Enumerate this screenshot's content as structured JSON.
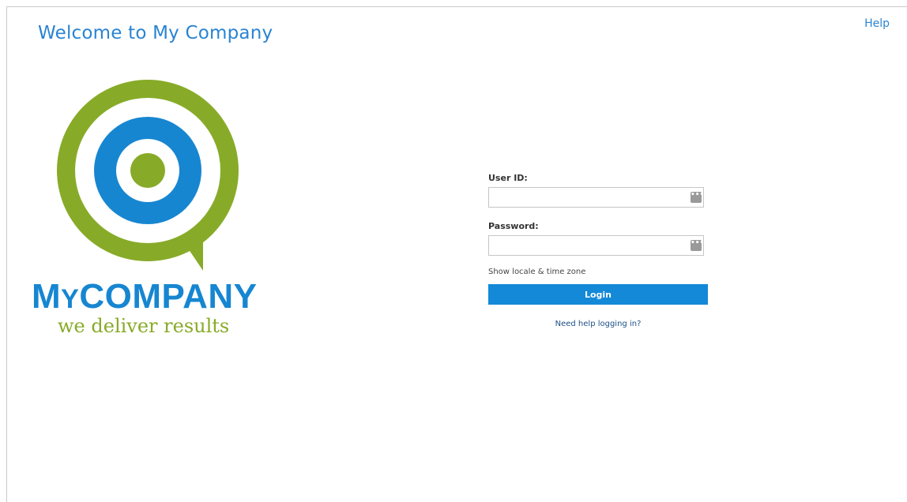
{
  "header": {
    "title": "Welcome to My Company",
    "help_label": "Help"
  },
  "logo": {
    "name_prefix": "M",
    "name_small": "Y",
    "name_rest": "COMPANY",
    "tagline": "we deliver results",
    "colors": {
      "green": "#87ab28",
      "blue": "#1786d1"
    }
  },
  "form": {
    "user_id_label": "User ID:",
    "user_id_value": "",
    "password_label": "Password:",
    "password_value": "",
    "keyboard_icon": "virtual-keyboard-icon",
    "locale_link": "Show locale & time zone",
    "login_label": "Login",
    "help_link": "Need help logging in?"
  },
  "colors": {
    "accent": "#1389d8",
    "title": "#2a84d2"
  }
}
